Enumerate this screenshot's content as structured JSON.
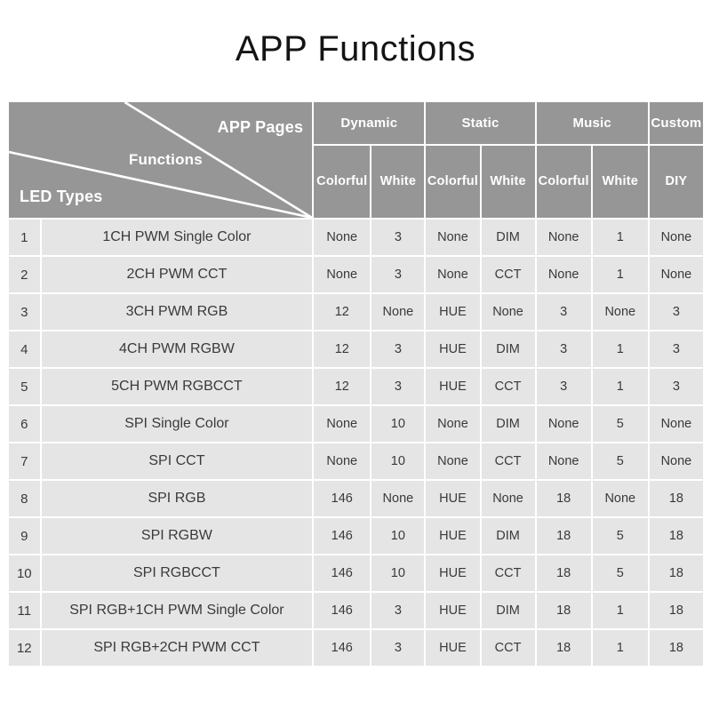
{
  "page": {
    "title": "APP Functions",
    "background_color": "#ffffff",
    "header_color": "#969696",
    "cell_color": "#e5e5e5",
    "text_color": "#3a3a3a"
  },
  "table": {
    "corner": {
      "app_pages_label": "APP Pages",
      "functions_label": "Functions",
      "led_types_label": "LED Types"
    },
    "group_headers": [
      {
        "label": "Dynamic",
        "span": 2
      },
      {
        "label": "Static",
        "span": 2
      },
      {
        "label": "Music",
        "span": 2
      },
      {
        "label": "Custom",
        "span": 1
      }
    ],
    "sub_headers": [
      "Colorful",
      "White",
      "Colorful",
      "White",
      "Colorful",
      "White",
      "DIY"
    ],
    "rows": [
      {
        "index": "1",
        "name": "1CH PWM Single Color",
        "values": [
          "None",
          "3",
          "None",
          "DIM",
          "None",
          "1",
          "None"
        ]
      },
      {
        "index": "2",
        "name": "2CH PWM CCT",
        "values": [
          "None",
          "3",
          "None",
          "CCT",
          "None",
          "1",
          "None"
        ]
      },
      {
        "index": "3",
        "name": "3CH PWM RGB",
        "values": [
          "12",
          "None",
          "HUE",
          "None",
          "3",
          "None",
          "3"
        ]
      },
      {
        "index": "4",
        "name": "4CH PWM RGBW",
        "values": [
          "12",
          "3",
          "HUE",
          "DIM",
          "3",
          "1",
          "3"
        ]
      },
      {
        "index": "5",
        "name": "5CH PWM RGBCCT",
        "values": [
          "12",
          "3",
          "HUE",
          "CCT",
          "3",
          "1",
          "3"
        ]
      },
      {
        "index": "6",
        "name": "SPI Single Color",
        "values": [
          "None",
          "10",
          "None",
          "DIM",
          "None",
          "5",
          "None"
        ]
      },
      {
        "index": "7",
        "name": "SPI CCT",
        "values": [
          "None",
          "10",
          "None",
          "CCT",
          "None",
          "5",
          "None"
        ]
      },
      {
        "index": "8",
        "name": "SPI RGB",
        "values": [
          "146",
          "None",
          "HUE",
          "None",
          "18",
          "None",
          "18"
        ]
      },
      {
        "index": "9",
        "name": "SPI RGBW",
        "values": [
          "146",
          "10",
          "HUE",
          "DIM",
          "18",
          "5",
          "18"
        ]
      },
      {
        "index": "10",
        "name": "SPI RGBCCT",
        "values": [
          "146",
          "10",
          "HUE",
          "CCT",
          "18",
          "5",
          "18"
        ]
      },
      {
        "index": "11",
        "name": "SPI RGB+1CH PWM Single Color",
        "values": [
          "146",
          "3",
          "HUE",
          "DIM",
          "18",
          "1",
          "18"
        ]
      },
      {
        "index": "12",
        "name": "SPI RGB+2CH PWM CCT",
        "values": [
          "146",
          "3",
          "HUE",
          "CCT",
          "18",
          "1",
          "18"
        ]
      }
    ]
  }
}
